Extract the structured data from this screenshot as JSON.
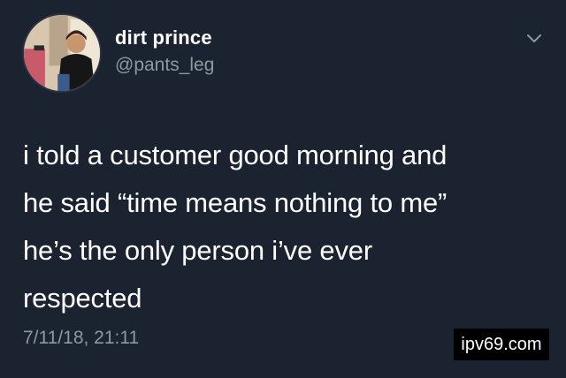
{
  "user": {
    "display_name": "dirt prince",
    "handle": "@pants_leg"
  },
  "tweet": {
    "lines": [
      "i told a customer good morning and",
      "he said “time means nothing to me”",
      "he’s the only person i’ve ever",
      "respected"
    ],
    "timestamp": "7/11/18, 21:11"
  },
  "watermark": "ipv69.com",
  "icons": {
    "menu": "chevron-down-icon"
  },
  "colors": {
    "background": "#1b2230",
    "text": "#ffffff",
    "muted": "#8b98a5"
  }
}
